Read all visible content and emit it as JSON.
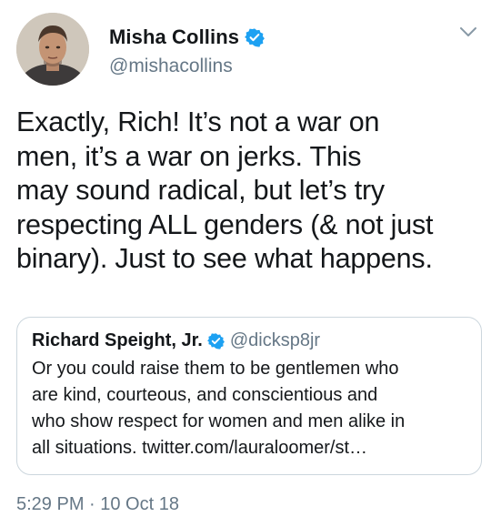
{
  "author": {
    "display_name": "Misha Collins",
    "handle": "@mishacollins",
    "verified": true
  },
  "tweet": {
    "lines": [
      "Exactly, Rich! It’s not a war on",
      "men, it’s a war on jerks. This",
      "may sound radical, but let’s try",
      "respecting ALL genders (& not just",
      "binary). Just to see what happens."
    ]
  },
  "quoted_tweet": {
    "display_name": "Richard Speight, Jr.",
    "handle": "@dicksp8jr",
    "verified": true,
    "lines": [
      "Or you could raise them to be gentlemen who",
      "are kind, courteous, and conscientious and",
      "who show respect for women and men alike in",
      "all situations. twitter.com/lauraloomer/st…"
    ]
  },
  "timestamp": "5:29 PM · 10 Oct 18",
  "icons": {
    "verified": "verified-badge-icon",
    "menu": "chevron-down-icon"
  },
  "colors": {
    "verified_blue": "#1da1f2",
    "secondary_text": "#657786",
    "border": "#ccd6dd"
  }
}
